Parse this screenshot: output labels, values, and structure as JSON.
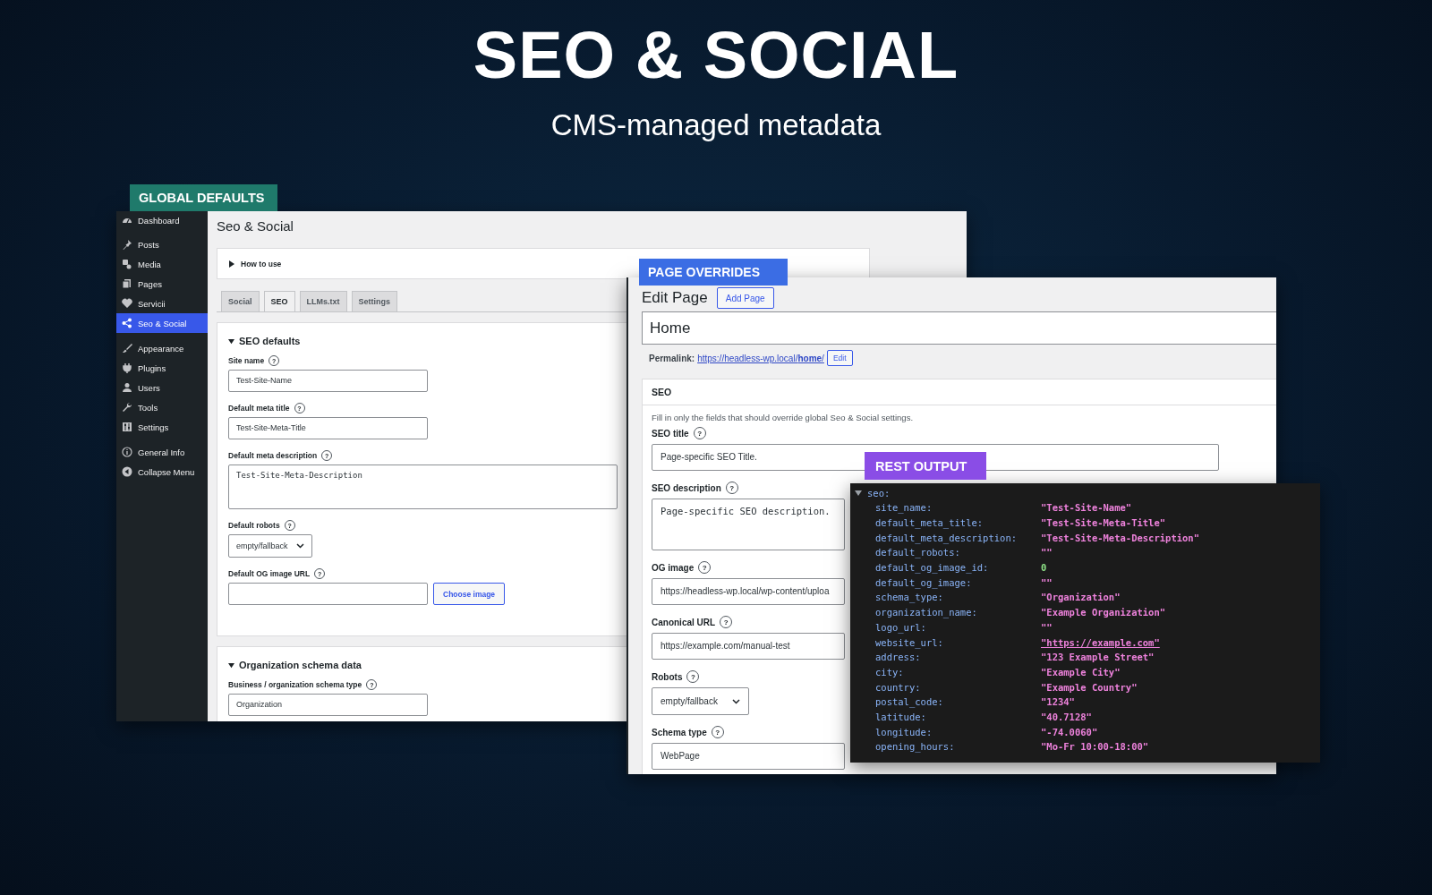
{
  "header": {
    "title": "SEO & SOCIAL",
    "subtitle": "CMS-managed metadata"
  },
  "global_defaults": {
    "badge": "GLOBAL DEFAULTS",
    "sidebar": {
      "groups": [
        [
          {
            "label": "Dashboard",
            "selected": false
          }
        ],
        [
          {
            "label": "Posts",
            "selected": false
          },
          {
            "label": "Media",
            "selected": false
          },
          {
            "label": "Pages",
            "selected": false
          },
          {
            "label": "Servicii",
            "selected": false
          },
          {
            "label": "Seo & Social",
            "selected": true
          }
        ],
        [
          {
            "label": "Appearance",
            "selected": false
          },
          {
            "label": "Plugins",
            "selected": false
          },
          {
            "label": "Users",
            "selected": false
          },
          {
            "label": "Tools",
            "selected": false
          },
          {
            "label": "Settings",
            "selected": false
          }
        ],
        [
          {
            "label": "General Info",
            "selected": false
          },
          {
            "label": "Collapse Menu",
            "selected": false
          }
        ]
      ]
    },
    "page_title": "Seo & Social",
    "disclosure": {
      "label": "How to use",
      "expanded": false
    },
    "tabs": [
      {
        "label": "Social",
        "selected": false
      },
      {
        "label": "SEO",
        "selected": true
      },
      {
        "label": "LLMs.txt",
        "selected": false
      },
      {
        "label": "Settings",
        "selected": false
      }
    ],
    "sections": [
      {
        "title": "SEO defaults",
        "expanded": true,
        "fields": [
          {
            "kind": "text",
            "label": "Site name",
            "help": "?",
            "value": "Test-Site-Name"
          },
          {
            "kind": "text",
            "label": "Default meta title",
            "help": "?",
            "value": "Test-Site-Meta-Title"
          },
          {
            "kind": "textarea",
            "label": "Default meta description",
            "help": "?",
            "value": "Test-Site-Meta-Description"
          },
          {
            "kind": "select",
            "label": "Default robots",
            "help": "?",
            "value": "empty/fallback"
          },
          {
            "kind": "image",
            "label": "Default OG image URL",
            "help": "?",
            "button": "Choose image"
          }
        ]
      },
      {
        "title": "Organization schema data",
        "expanded": true,
        "fields": [
          {
            "kind": "text",
            "label": "Business / organization schema type",
            "help": "?",
            "value": "Organization"
          }
        ]
      }
    ]
  },
  "page_overrides": {
    "badge": "PAGE OVERRIDES",
    "heading": "Edit Page",
    "add_button": "Add Page",
    "post_title": "Home",
    "permalink": {
      "label": "Permalink:",
      "url": "https://headless-wp.local/**home**/",
      "edit": "Edit"
    },
    "seo_box": {
      "title": "SEO",
      "hint": "Fill in only the fields that should override global Seo & Social settings.",
      "fields": [
        {
          "kind": "text",
          "label": "SEO title",
          "help": "?",
          "value": "Page-specific SEO Title."
        },
        {
          "kind": "textarea",
          "label": "SEO description",
          "help": "?",
          "value": "Page-specific SEO description."
        },
        {
          "kind": "text",
          "label": "OG image",
          "help": "?",
          "value": "https://headless-wp.local/wp-content/uploa"
        },
        {
          "kind": "text",
          "label": "Canonical URL",
          "help": "?",
          "value": "https://example.com/manual-test"
        },
        {
          "kind": "select",
          "label": "Robots",
          "help": "?",
          "value": "empty/fallback"
        },
        {
          "kind": "text",
          "label": "Schema type",
          "help": "?",
          "value": "WebPage"
        }
      ]
    }
  },
  "rest_output": {
    "badge": "REST OUTPUT",
    "root": {
      "key": "seo:",
      "expanded": true,
      "entries": [
        {
          "key": "site_name:",
          "value": "\"Test-Site-Name\"",
          "color": "#ee82dc",
          "underlined": false
        },
        {
          "key": "default_meta_title:",
          "value": "\"Test-Site-Meta-Title\"",
          "color": "#ee82dc",
          "underlined": false
        },
        {
          "key": "default_meta_description:",
          "value": "\"Test-Site-Meta-Description\"",
          "color": "#ee82dc",
          "underlined": false
        },
        {
          "key": "default_robots:",
          "value": "\"\"",
          "color": "#ee82dc",
          "underlined": false
        },
        {
          "key": "default_og_image_id:",
          "value": "0",
          "color": "#8fe388",
          "underlined": false
        },
        {
          "key": "default_og_image:",
          "value": "\"\"",
          "color": "#ee82dc",
          "underlined": false
        },
        {
          "key": "schema_type:",
          "value": "\"Organization\"",
          "color": "#ee82dc",
          "underlined": false
        },
        {
          "key": "organization_name:",
          "value": "\"Example Organization\"",
          "color": "#ee82dc",
          "underlined": false
        },
        {
          "key": "logo_url:",
          "value": "\"\"",
          "color": "#ee82dc",
          "underlined": false
        },
        {
          "key": "website_url:",
          "value": "\"https://example.com\"",
          "color": "#ee82dc",
          "underlined": true
        },
        {
          "key": "address:",
          "value": "\"123 Example Street\"",
          "color": "#ee82dc",
          "underlined": false
        },
        {
          "key": "city:",
          "value": "\"Example City\"",
          "color": "#ee82dc",
          "underlined": false
        },
        {
          "key": "country:",
          "value": "\"Example Country\"",
          "color": "#ee82dc",
          "underlined": false
        },
        {
          "key": "postal_code:",
          "value": "\"1234\"",
          "color": "#ee82dc",
          "underlined": false
        },
        {
          "key": "latitude:",
          "value": "\"40.7128\"",
          "color": "#ee82dc",
          "underlined": false
        },
        {
          "key": "longitude:",
          "value": "\"-74.0060\"",
          "color": "#ee82dc",
          "underlined": false
        },
        {
          "key": "opening_hours:",
          "value": "\"Mo-Fr 10:00-18:00\"",
          "color": "#ee82dc",
          "underlined": false
        }
      ]
    }
  }
}
